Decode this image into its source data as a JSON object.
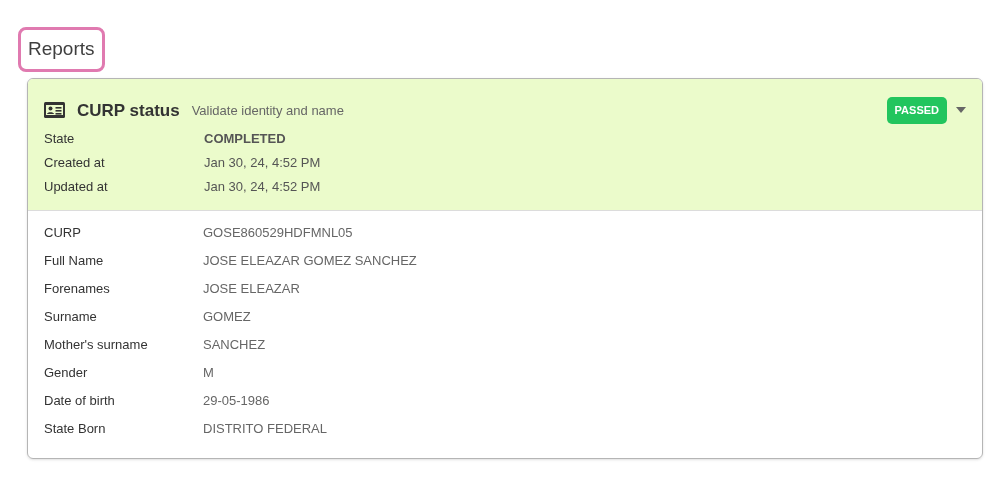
{
  "heading": {
    "text": "Reports",
    "highlighted": true
  },
  "report": {
    "title": "CURP status",
    "subtitle": "Validate identity and name",
    "status": {
      "label": "PASSED",
      "kind": "passed"
    },
    "expanded": true,
    "meta": [
      {
        "label": "State",
        "value": "COMPLETED",
        "strong": true
      },
      {
        "label": "Created at",
        "value": "Jan 30, 24, 4:52 PM",
        "strong": false
      },
      {
        "label": "Updated at",
        "value": "Jan 30, 24, 4:52 PM",
        "strong": false
      }
    ],
    "fields": [
      {
        "label": "CURP",
        "value": "GOSE860529HDFMNL05"
      },
      {
        "label": "Full Name",
        "value": "JOSE ELEAZAR GOMEZ SANCHEZ"
      },
      {
        "label": "Forenames",
        "value": "JOSE ELEAZAR"
      },
      {
        "label": "Surname",
        "value": "GOMEZ"
      },
      {
        "label": "Mother's surname",
        "value": "SANCHEZ"
      },
      {
        "label": "Gender",
        "value": "M"
      },
      {
        "label": "Date of birth",
        "value": "29-05-1986"
      },
      {
        "label": "State Born",
        "value": "DISTRITO FEDERAL"
      }
    ]
  }
}
